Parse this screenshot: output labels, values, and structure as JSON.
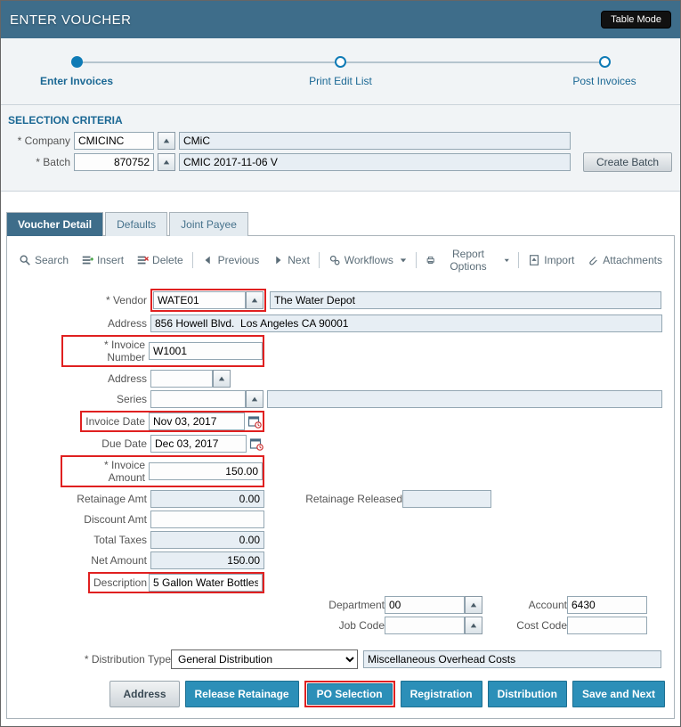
{
  "title": "ENTER VOUCHER",
  "table_mode": "Table Mode",
  "steps": {
    "s1": "Enter Invoices",
    "s2": "Print Edit List",
    "s3": "Post Invoices"
  },
  "sel": {
    "title": "SELECTION CRITERIA",
    "company_lbl": "* Company",
    "company_code": "CMICINC",
    "company_name": "CMiC",
    "batch_lbl": "* Batch",
    "batch_code": "870752",
    "batch_name": "CMIC 2017-11-06 V",
    "create_batch": "Create Batch"
  },
  "tabs": {
    "detail": "Voucher Detail",
    "defaults": "Defaults",
    "joint": "Joint Payee"
  },
  "toolbar": {
    "search": "Search",
    "insert": "Insert",
    "delete": "Delete",
    "prev": "Previous",
    "next": "Next",
    "workflows": "Workflows",
    "report": "Report Options",
    "import": "Import",
    "attach": "Attachments"
  },
  "vd": {
    "vendor_lbl": "* Vendor",
    "vendor_code": "WATE01",
    "vendor_name": "The Water Depot",
    "address_lbl": "Address",
    "address_val": "856 Howell Blvd.  Los Angeles CA 90001",
    "inv_no_lbl": "* Invoice Number",
    "inv_no": "W1001",
    "address2_lbl": "Address",
    "address2": "",
    "series_lbl": "Series",
    "series": "",
    "inv_date_lbl": "Invoice Date",
    "inv_date": "Nov 03, 2017",
    "due_date_lbl": "Due Date",
    "due_date": "Dec 03, 2017",
    "inv_amt_lbl": "* Invoice Amount",
    "inv_amt": "150.00",
    "ret_amt_lbl": "Retainage Amt",
    "ret_amt": "0.00",
    "ret_rel_lbl": "Retainage Released",
    "ret_rel": "",
    "disc_amt_lbl": "Discount Amt",
    "disc_amt": "",
    "tax_lbl": "Total Taxes",
    "tax": "0.00",
    "net_lbl": "Net Amount",
    "net": "150.00",
    "desc_lbl": "Description",
    "desc": "5 Gallon Water Bottles",
    "dept_lbl": "Department",
    "dept": "00",
    "acct_lbl": "Account",
    "acct": "6430",
    "job_lbl": "Job Code",
    "job": "",
    "cost_lbl": "Cost Code",
    "cost": "",
    "dist_type_lbl": "* Distribution Type",
    "dist_type": "General Distribution",
    "dist_type_desc": "Miscellaneous Overhead Costs"
  },
  "footer": {
    "address": "Address",
    "release": "Release Retainage",
    "po": "PO Selection",
    "reg": "Registration",
    "dist": "Distribution",
    "save": "Save and Next"
  }
}
